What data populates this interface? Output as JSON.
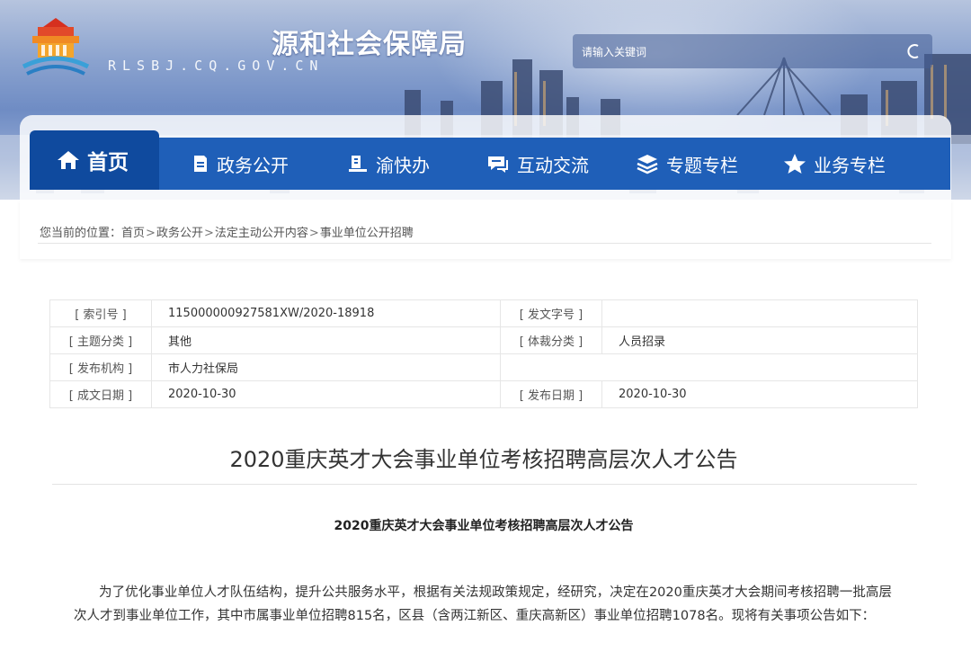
{
  "header": {
    "site_title": "源和社会保障局",
    "site_domain": "RLSBJ.CQ.GOV.CN",
    "search_placeholder": "请输入关键词"
  },
  "nav": {
    "items": [
      {
        "label": "首页",
        "icon": "home-icon",
        "active": true
      },
      {
        "label": "政务公开",
        "icon": "document-icon"
      },
      {
        "label": "渝快办",
        "icon": "service-hall-icon"
      },
      {
        "label": "互动交流",
        "icon": "chat-bubble-icon"
      },
      {
        "label": "专题专栏",
        "icon": "layers-icon"
      },
      {
        "label": "业务专栏",
        "icon": "star-icon"
      }
    ]
  },
  "breadcrumb": {
    "prefix": "您当前的位置：",
    "links": [
      "首页",
      "政务公开",
      "法定主动公开内容",
      "事业单位公开招聘"
    ],
    "separator": ">"
  },
  "meta": {
    "rows": [
      {
        "k1": "[ 索引号 ]",
        "v1": "115000000927581XW/2020-18918",
        "k2": "[ 发文字号 ]",
        "v2": ""
      },
      {
        "k1": "[ 主题分类 ]",
        "v1": "其他",
        "k2": "[ 体裁分类 ]",
        "v2": "人员招录"
      },
      {
        "k1": "[ 发布机构 ]",
        "v1": "市人力社保局"
      },
      {
        "k1": "[ 成文日期 ]",
        "v1": "2020-10-30",
        "k2": "[ 发布日期 ]",
        "v2": "2020-10-30"
      }
    ]
  },
  "article": {
    "title": "2020重庆英才大会事业单位考核招聘高层次人才公告",
    "subtitle": "2020重庆英才大会事业单位考核招聘高层次人才公告",
    "paragraph": "为了优化事业单位人才队伍结构，提升公共服务水平，根据有关法规政策规定，经研究，决定在2020重庆英才大会期间考核招聘一批高层次人才到事业单位工作，其中市属事业单位招聘815名，区县（含两江新区、重庆高新区）事业单位招聘1078名。现将有关事项公告如下："
  },
  "colors": {
    "nav_bg": "#1f5fb8",
    "nav_active_bg": "#0f4a9e",
    "banner_top": "#b6c4de"
  }
}
